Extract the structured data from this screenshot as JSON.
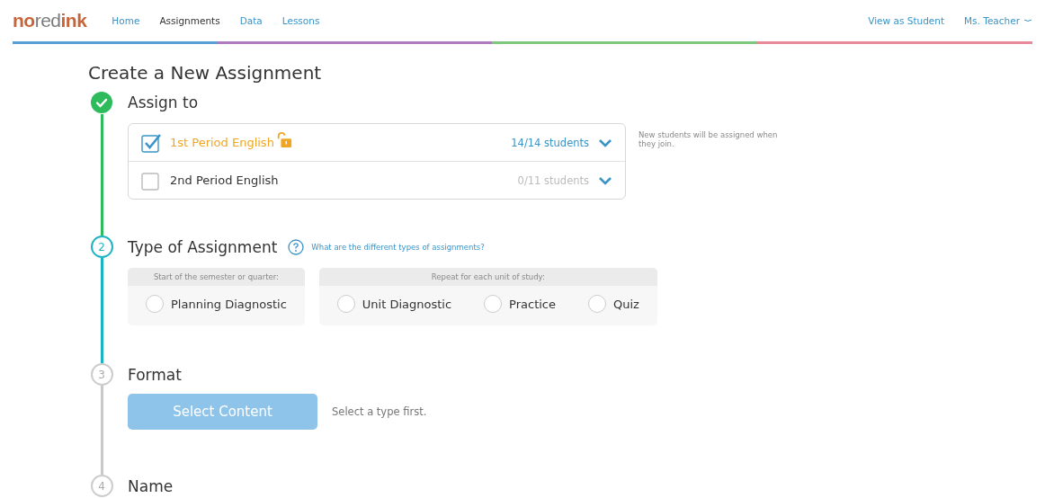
{
  "nav": {
    "logo": [
      {
        "text": "no",
        "color": "#c8643a"
      },
      {
        "text": "red",
        "color": "#7b7b7b"
      },
      {
        "text": "ink",
        "color": "#c8643a"
      }
    ],
    "items": [
      {
        "label": "Home",
        "selected": false
      },
      {
        "label": "Assignments",
        "selected": true
      },
      {
        "label": "Data",
        "selected": false
      },
      {
        "label": "Lessons",
        "selected": false
      }
    ],
    "right": [
      "View as Student"
    ],
    "user": "Ms. Teacher"
  },
  "title": "Create a New Assignment",
  "steps": [
    {
      "kind": "classes",
      "done": true,
      "title": "Assign to",
      "classes": [
        {
          "name": "1st Period English",
          "checked": true,
          "unlocked": true,
          "count": "14/14 students"
        },
        {
          "name": "2nd Period English",
          "checked": false,
          "unlocked": false,
          "count": "0/11 students"
        }
      ],
      "note": "New students will be assigned when they join."
    },
    {
      "kind": "types",
      "done": false,
      "active": true,
      "number": "2",
      "title": "Type of Assignment",
      "help": "What are the different types of assignments?",
      "groups": [
        {
          "heading": "Start of the semester or quarter:",
          "options": [
            {
              "label": "Planning Diagnostic",
              "selected": false
            }
          ]
        },
        {
          "heading": "Repeat for each unit of study:",
          "options": [
            {
              "label": "Unit Diagnostic",
              "selected": false
            },
            {
              "label": "Practice",
              "selected": false
            },
            {
              "label": "Quiz",
              "selected": false
            }
          ]
        }
      ]
    },
    {
      "kind": "format",
      "done": false,
      "active": false,
      "number": "3",
      "title": "Format",
      "button": {
        "label": "Select Content",
        "disabled": true
      },
      "hint": "Select a type first."
    },
    {
      "kind": "name",
      "done": false,
      "active": false,
      "number": "4",
      "title": "Name"
    }
  ]
}
